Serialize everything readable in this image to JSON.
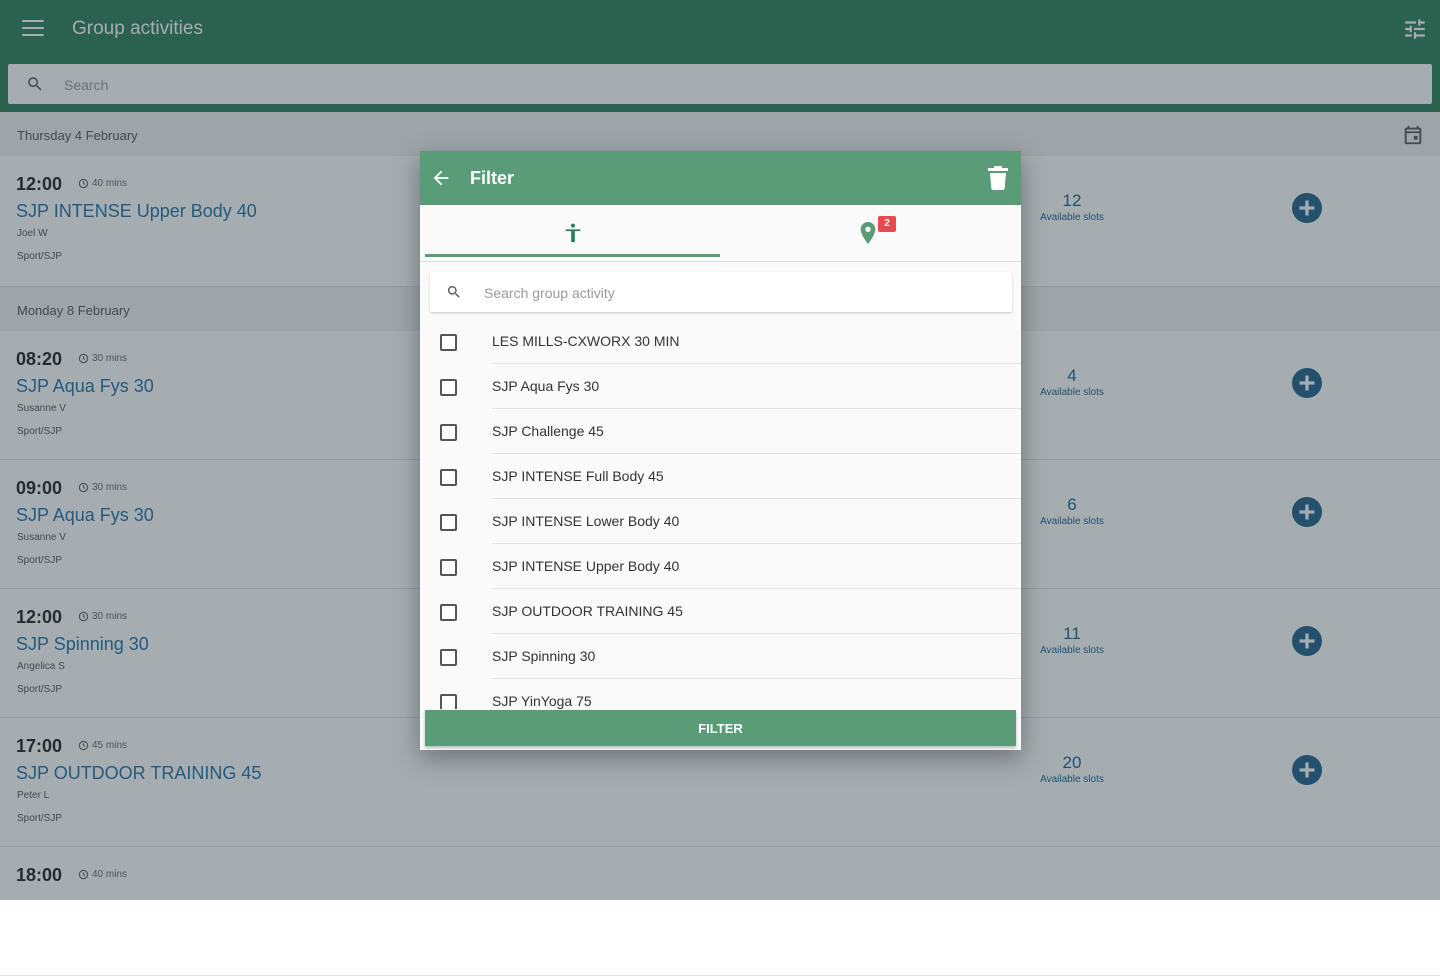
{
  "appbar": {
    "title": "Group activities",
    "color": "#2e7d57"
  },
  "search": {
    "placeholder": "Search"
  },
  "list": {
    "groups": [
      {
        "date": "Thursday 4 February",
        "items": [
          {
            "time": "12:00",
            "duration": "40 mins",
            "name": "SJP INTENSE Upper Body 40",
            "instructor": "Joel W",
            "location": "Sport/SJP",
            "slots": "12",
            "slots_label": "Available slots"
          }
        ]
      },
      {
        "date": "Monday 8 February",
        "items": [
          {
            "time": "08:20",
            "duration": "30 mins",
            "name": "SJP Aqua Fys 30",
            "instructor": "Susanne V",
            "location": "Sport/SJP",
            "slots": "4",
            "slots_label": "Available slots"
          },
          {
            "time": "09:00",
            "duration": "30 mins",
            "name": "SJP Aqua Fys 30",
            "instructor": "Susanne V",
            "location": "Sport/SJP",
            "slots": "6",
            "slots_label": "Available slots"
          },
          {
            "time": "12:00",
            "duration": "30 mins",
            "name": "SJP Spinning 30",
            "instructor": "Angelica S",
            "location": "Sport/SJP",
            "slots": "11",
            "slots_label": "Available slots"
          },
          {
            "time": "17:00",
            "duration": "45 mins",
            "name": "SJP OUTDOOR TRAINING 45",
            "instructor": "Peter L",
            "location": "Sport/SJP",
            "slots": "20",
            "slots_label": "Available slots"
          },
          {
            "time": "18:00",
            "duration": "40 mins",
            "name": "",
            "instructor": "",
            "location": "",
            "slots": "",
            "slots_label": ""
          }
        ]
      }
    ]
  },
  "dialog": {
    "title": "Filter",
    "header_color": "#5a9c77",
    "tabs": [
      {
        "icon": "activity-icon",
        "active": true
      },
      {
        "icon": "location-pin-icon",
        "badge": "2"
      }
    ],
    "search_placeholder": "Search group activity",
    "options": [
      "LES MILLS-CXWORX 30 MIN",
      "SJP Aqua Fys 30",
      "SJP Challenge 45",
      "SJP INTENSE Full Body 45",
      "SJP INTENSE Lower Body 40",
      "SJP INTENSE Upper Body 40",
      "SJP OUTDOOR TRAINING 45",
      "SJP Spinning 30",
      "SJP YinYoga 75"
    ],
    "filter_label": "FILTER"
  }
}
